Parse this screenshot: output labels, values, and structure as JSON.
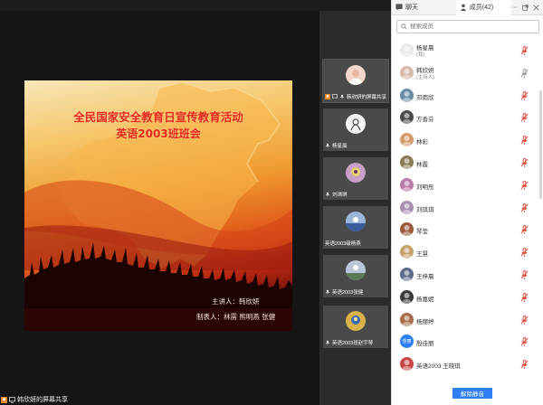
{
  "slide": {
    "title_line1": "全民国家安全教育日宣传教育活动",
    "title_line2": "英语2003班班会",
    "speaker": "主讲人：韩欣妍",
    "makers": "制表人：林雳  熊明燕  张健"
  },
  "share_badge": "韩欣妍的屏幕共享",
  "thumbnails": [
    {
      "label": "韩欣妍的屏幕共享",
      "avatar_color": "#f2d6c9",
      "active": true
    },
    {
      "label": "杨星晨",
      "avatar_color": "#f4f4f4"
    },
    {
      "label": "刘琪琪",
      "avatar_color": "#c7a0c6"
    },
    {
      "label": "英语2003级杨燕",
      "avatar_color": "#9bb5d8"
    },
    {
      "label": "英语2003张健",
      "avatar_color": "#b9c7d8"
    },
    {
      "label": "英语2003班赵宇琴",
      "avatar_color": "#d9b24a"
    }
  ],
  "panel": {
    "tab_chat": "聊天",
    "tab_members": "成员(42)",
    "tools_more": "···",
    "search_placeholder": "搜索成员",
    "unmute_all": "解除静音"
  },
  "members": [
    {
      "name": "杨星晨",
      "sub": "(我)",
      "color": "#e9e9e9"
    },
    {
      "name": "韩欣妍",
      "sub": "(主持人)",
      "color": "#d7b9a8"
    },
    {
      "name": "邓雨欣",
      "color": "#6b8ca8"
    },
    {
      "name": "方香芬",
      "color": "#4a4a4a"
    },
    {
      "name": "林彩",
      "color": "#d49a6a"
    },
    {
      "name": "林霞",
      "color": "#8a7a55"
    },
    {
      "name": "刘明彤",
      "color": "#b97aa8"
    },
    {
      "name": "刘琪琪",
      "color": "#a88fb0"
    },
    {
      "name": "琴莹",
      "color": "#9a5a3a"
    },
    {
      "name": "王慧",
      "color": "#c9a16a"
    },
    {
      "name": "王梓晨",
      "color": "#5a6a8a"
    },
    {
      "name": "杨嘉妮",
      "color": "#3a3a3a"
    },
    {
      "name": "杨丽婷",
      "color": "#a86a4a"
    },
    {
      "name": "殷佳丽",
      "color": "#2d7ef0",
      "initials": "佳丽"
    },
    {
      "name": "英语2003 王晓琪",
      "color": "#c84848"
    }
  ]
}
